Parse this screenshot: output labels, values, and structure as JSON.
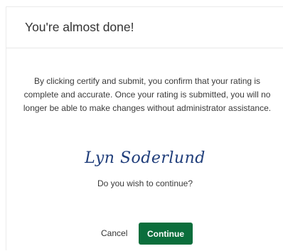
{
  "dialog": {
    "title": "You're almost done!",
    "message": "By clicking certify and submit, you confirm that your rating is complete and accurate. Once your rating is submitted, you will no longer be able to make changes without administrator assistance.",
    "signature": "Lyn Soderlund",
    "question": "Do you wish to continue?",
    "cancel_label": "Cancel",
    "continue_label": "Continue"
  },
  "colors": {
    "primary_button": "#0b6e3c",
    "signature": "#1f3d7a"
  }
}
